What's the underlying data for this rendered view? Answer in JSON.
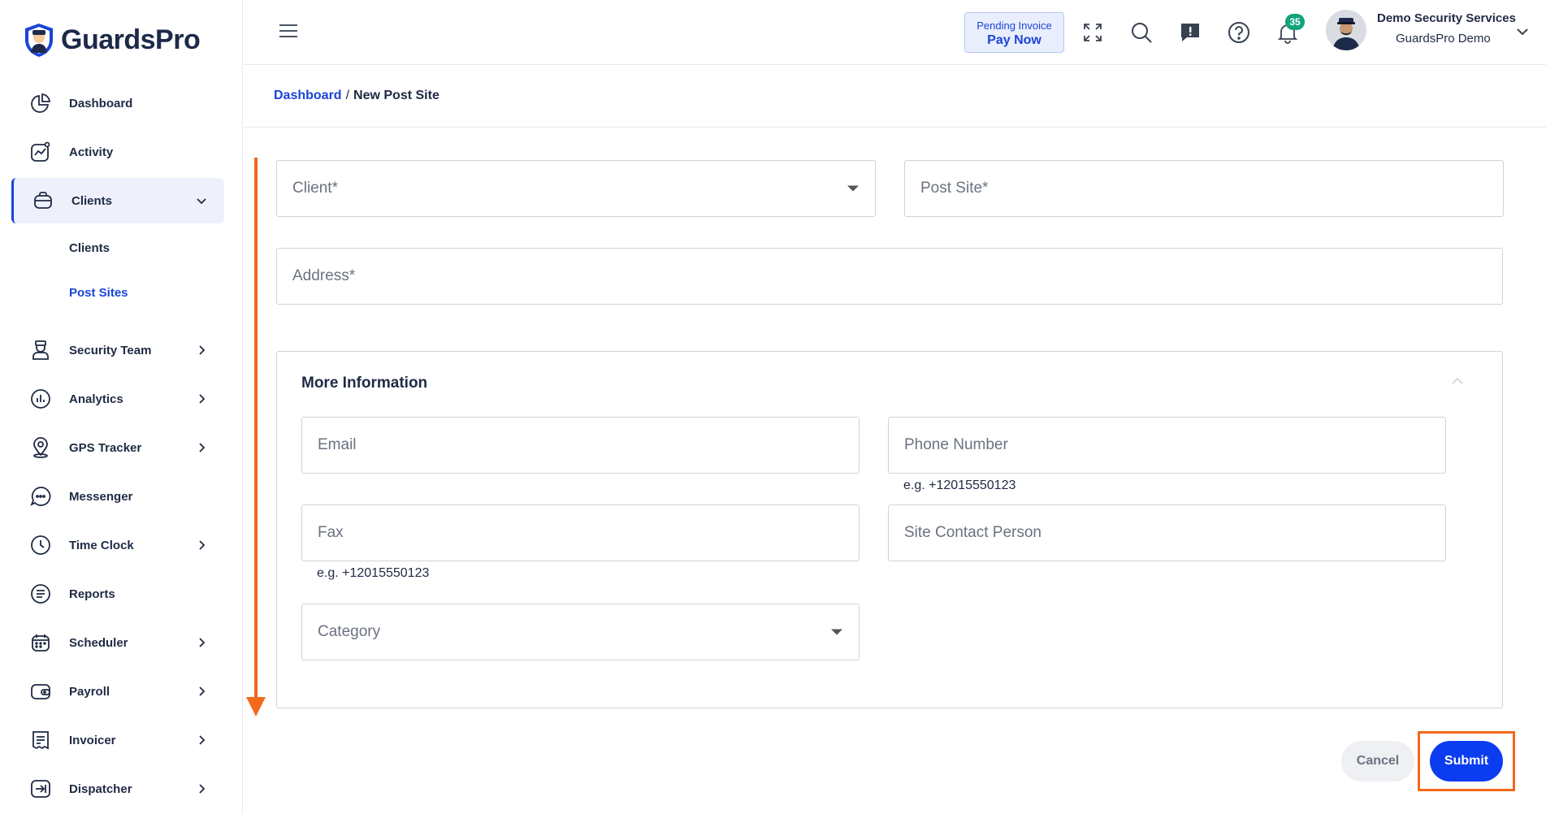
{
  "brand": {
    "name": "GuardsPro"
  },
  "sidebar": {
    "items": [
      {
        "label": "Dashboard",
        "icon": "pie-chart-icon",
        "has_children": false
      },
      {
        "label": "Activity",
        "icon": "activity-chart-icon",
        "has_children": false
      },
      {
        "label": "Clients",
        "icon": "briefcase-icon",
        "has_children": true,
        "expanded": true
      },
      {
        "label": "Security Team",
        "icon": "guard-icon",
        "has_children": true
      },
      {
        "label": "Analytics",
        "icon": "analytics-icon",
        "has_children": true
      },
      {
        "label": "GPS Tracker",
        "icon": "location-pin-icon",
        "has_children": true
      },
      {
        "label": "Messenger",
        "icon": "chat-bubble-icon",
        "has_children": false
      },
      {
        "label": "Time Clock",
        "icon": "clock-icon",
        "has_children": true
      },
      {
        "label": "Reports",
        "icon": "report-list-icon",
        "has_children": false
      },
      {
        "label": "Scheduler",
        "icon": "calendar-icon",
        "has_children": true
      },
      {
        "label": "Payroll",
        "icon": "wallet-icon",
        "has_children": true
      },
      {
        "label": "Invoicer",
        "icon": "invoice-icon",
        "has_children": true
      },
      {
        "label": "Dispatcher",
        "icon": "dispatch-icon",
        "has_children": true
      }
    ],
    "clients_sub": [
      {
        "label": "Clients"
      },
      {
        "label": "Post Sites",
        "current": true
      }
    ]
  },
  "topbar": {
    "pending_invoice": "Pending Invoice",
    "pay_now": "Pay Now",
    "notification_count": "35",
    "user_name": "Demo Security Services",
    "user_company": "GuardsPro Demo"
  },
  "breadcrumb": {
    "root": "Dashboard",
    "separator": "/",
    "current": "New Post Site"
  },
  "form": {
    "client_placeholder": "Client*",
    "post_site_placeholder": "Post Site*",
    "address_placeholder": "Address*",
    "more_info_title": "More Information",
    "email_placeholder": "Email",
    "phone_placeholder": "Phone Number",
    "phone_helper": "e.g. +12015550123",
    "fax_placeholder": "Fax",
    "fax_helper": "e.g. +12015550123",
    "contact_placeholder": "Site Contact Person",
    "category_placeholder": "Category"
  },
  "actions": {
    "cancel": "Cancel",
    "submit": "Submit"
  },
  "colors": {
    "accent": "#1a44d8",
    "submit": "#0b3cf0",
    "annotation": "#f26a1b",
    "badge": "#12a37a"
  }
}
